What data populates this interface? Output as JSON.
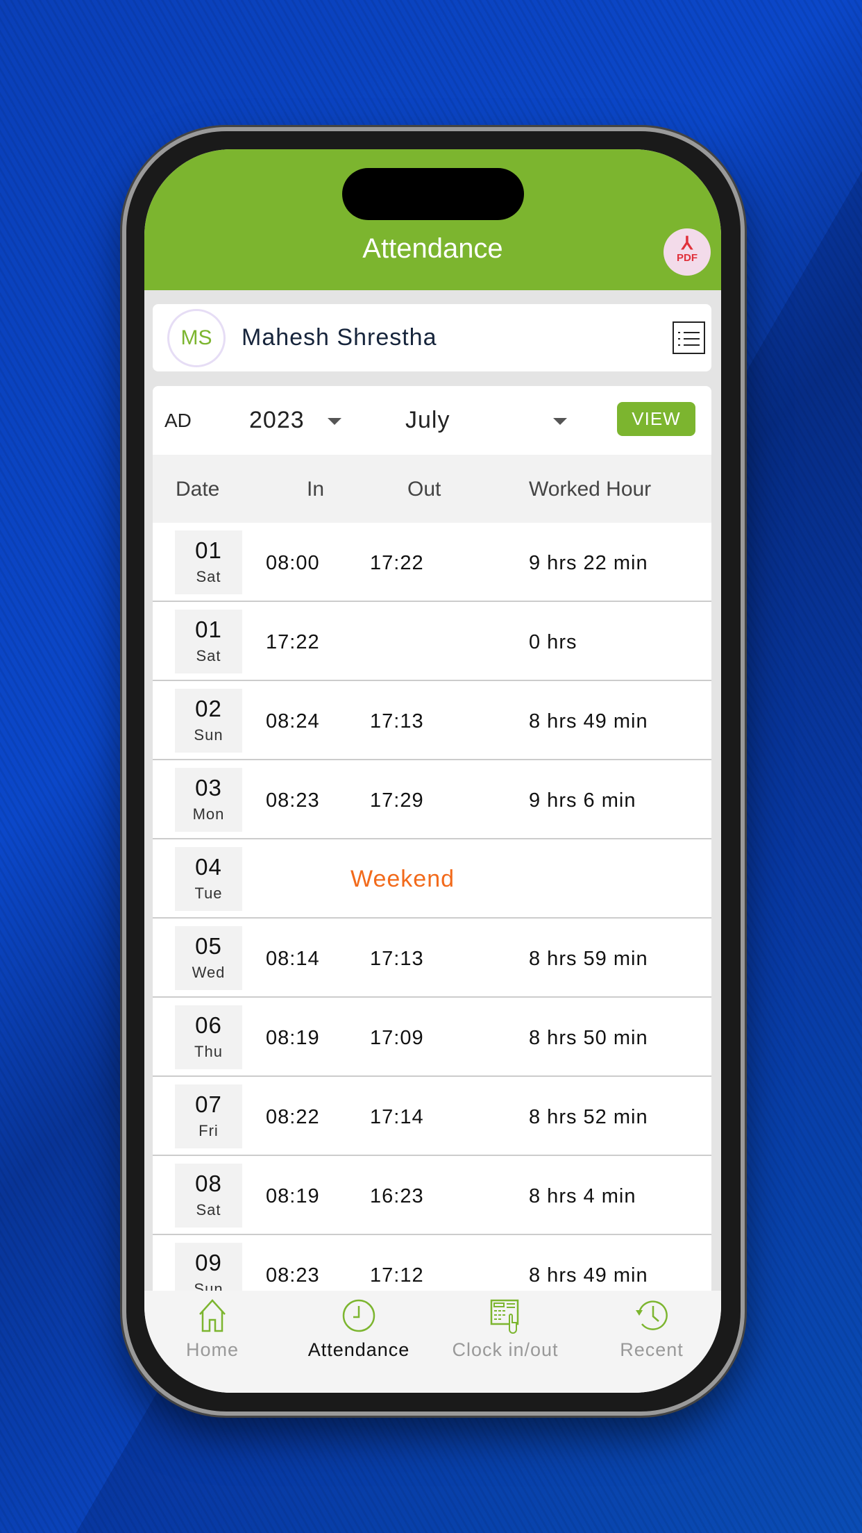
{
  "header": {
    "title": "Attendance",
    "pdf_label": "PDF"
  },
  "user": {
    "initials": "MS",
    "name": "Mahesh Shrestha"
  },
  "filter": {
    "calendar": "AD",
    "year": "2023",
    "month": "July",
    "view_label": "VIEW"
  },
  "table": {
    "headers": {
      "date": "Date",
      "in": "In",
      "out": "Out",
      "worked": "Worked Hour"
    },
    "rows": [
      {
        "day": "01",
        "weekday": "Sat",
        "in": "08:00",
        "out": "17:22",
        "worked": "9 hrs 22 min"
      },
      {
        "day": "01",
        "weekday": "Sat",
        "in": "17:22",
        "out": "",
        "worked": "0 hrs"
      },
      {
        "day": "02",
        "weekday": "Sun",
        "in": "08:24",
        "out": "17:13",
        "worked": "8 hrs 49 min"
      },
      {
        "day": "03",
        "weekday": "Mon",
        "in": "08:23",
        "out": "17:29",
        "worked": "9 hrs 6 min"
      },
      {
        "day": "04",
        "weekday": "Tue",
        "status": "Weekend"
      },
      {
        "day": "05",
        "weekday": "Wed",
        "in": "08:14",
        "out": "17:13",
        "worked": "8 hrs 59 min"
      },
      {
        "day": "06",
        "weekday": "Thu",
        "in": "08:19",
        "out": "17:09",
        "worked": "8 hrs 50 min"
      },
      {
        "day": "07",
        "weekday": "Fri",
        "in": "08:22",
        "out": "17:14",
        "worked": "8 hrs 52 min"
      },
      {
        "day": "08",
        "weekday": "Sat",
        "in": "08:19",
        "out": "16:23",
        "worked": "8 hrs 4 min"
      },
      {
        "day": "09",
        "weekday": "Sun",
        "in": "08:23",
        "out": "17:12",
        "worked": "8 hrs 49 min"
      }
    ]
  },
  "nav": [
    {
      "label": "Home",
      "icon": "home-icon"
    },
    {
      "label": "Attendance",
      "icon": "clock-icon",
      "active": true
    },
    {
      "label": "Clock in/out",
      "icon": "keypad-touch-icon"
    },
    {
      "label": "Recent",
      "icon": "history-icon"
    }
  ],
  "colors": {
    "primary": "#7cb52f",
    "weekend": "#f26a1b",
    "pdf": "#e0303a"
  }
}
